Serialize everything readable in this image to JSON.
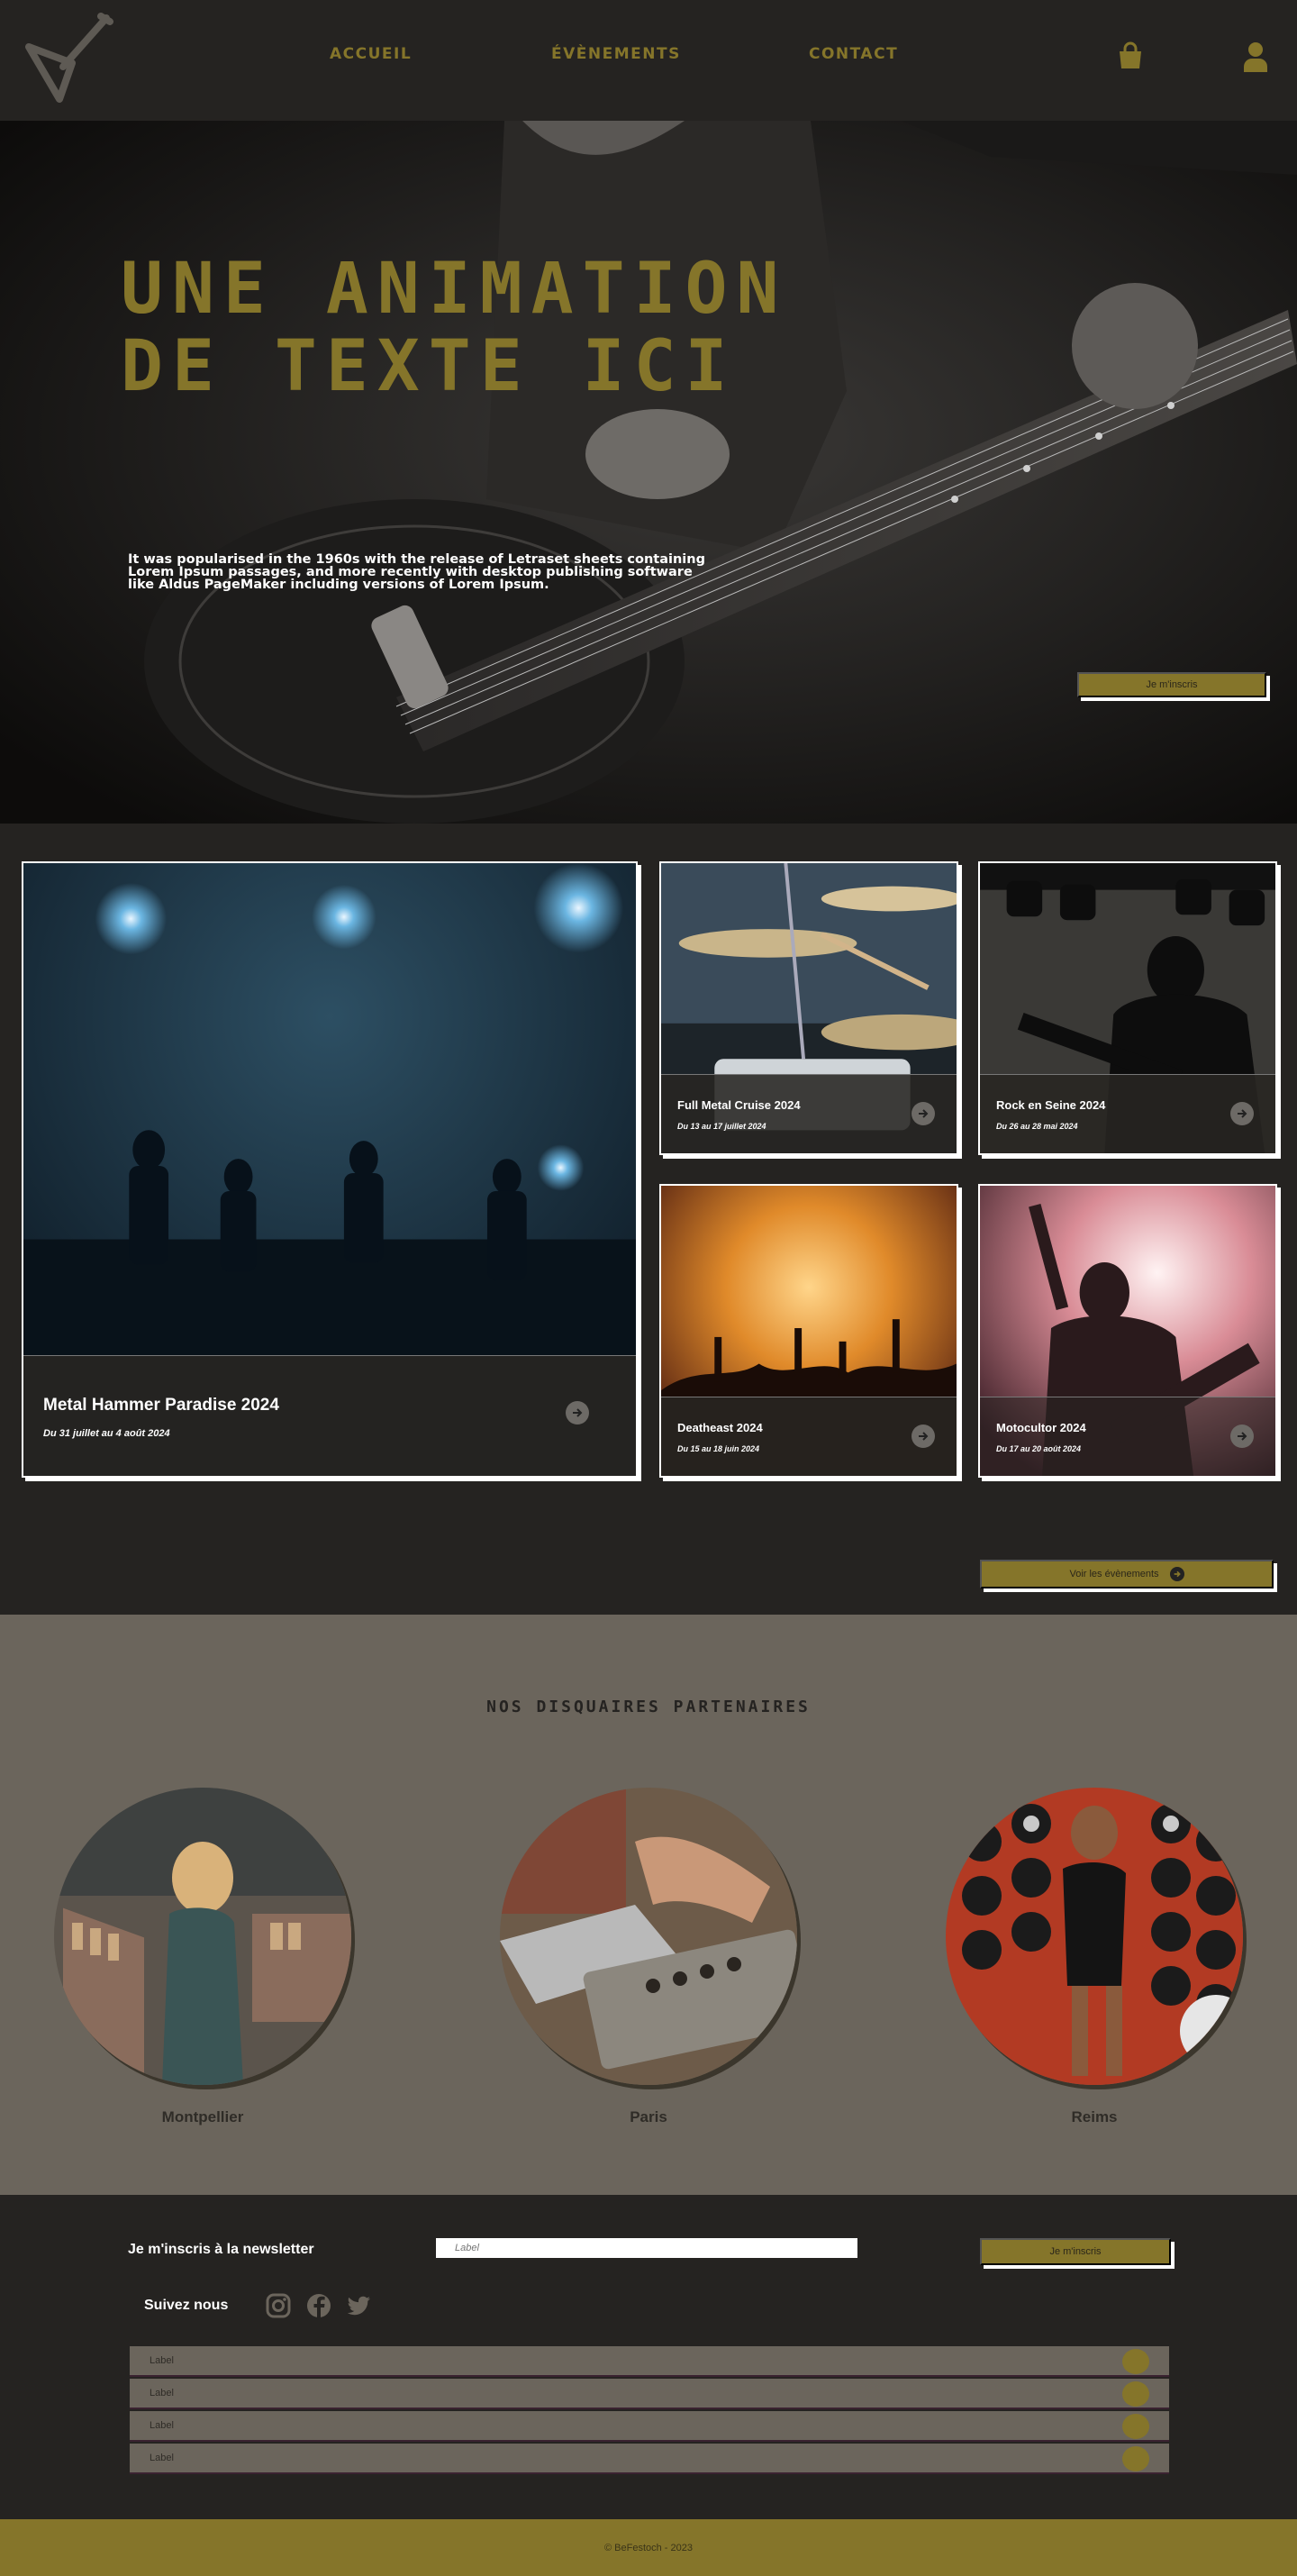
{
  "brand": {
    "accent": "#85752a",
    "dark": "#252321",
    "taupe": "#6b655c"
  },
  "nav": {
    "items": [
      {
        "label": "ACCUEIL"
      },
      {
        "label": "ÉVÈNEMENTS"
      },
      {
        "label": "CONTACT"
      }
    ],
    "icons": [
      "guitar-logo-icon",
      "shopping-bag-icon",
      "user-icon"
    ]
  },
  "hero": {
    "title": "UNE ANIMATION\nDE TEXTE ICI",
    "text": "It was popularised in the 1960s with the release of Letraset sheets containing Lorem Ipsum passages, and more recently with desktop publishing software like Aldus PageMaker including versions of Lorem Ipsum.",
    "button_label": "Je m'inscris"
  },
  "events": {
    "items": [
      {
        "title": "Metal Hammer Paradise 2024",
        "date": "Du 31 juillet au 4 août 2024"
      },
      {
        "title": "Full Metal Cruise 2024",
        "date": "Du 13 au 17 juillet 2024"
      },
      {
        "title": "Rock en Seine 2024",
        "date": "Du 26 au 28 mai 2024"
      },
      {
        "title": "Deatheast 2024",
        "date": "Du 15 au 18 juin 2024"
      },
      {
        "title": "Motocultor 2024",
        "date": "Du 17 au 20 août 2024"
      }
    ],
    "more_label": "Voir les évènements"
  },
  "partners": {
    "title": "NOS DISQUAIRES PARTENAIRES",
    "cities": [
      "Montpellier",
      "Paris",
      "Reims"
    ]
  },
  "footer": {
    "newsletter_label": "Je m'inscris à la newsletter",
    "newsletter_placeholder": "Label",
    "newsletter_button": "Je m'inscris",
    "follow_label": "Suivez nous",
    "social": [
      "instagram-icon",
      "facebook-icon",
      "twitter-icon"
    ],
    "accordion": [
      "Label",
      "Label",
      "Label",
      "Label"
    ],
    "copyright": "© BeFestoch - 2023"
  }
}
